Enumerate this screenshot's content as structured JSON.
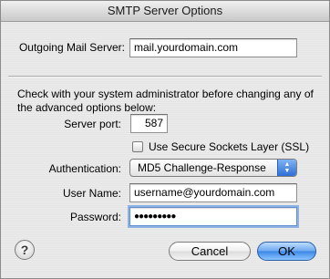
{
  "window": {
    "title": "SMTP Server Options"
  },
  "outgoing": {
    "label": "Outgoing Mail Server:",
    "value": "mail.yourdomain.com"
  },
  "note": "Check with your system administrator before changing any of the advanced options below:",
  "port": {
    "label": "Server port:",
    "value": "587"
  },
  "ssl": {
    "label": "Use Secure Sockets Layer (SSL)",
    "checked": false
  },
  "authentication": {
    "label": "Authentication:",
    "selected": "MD5 Challenge-Response"
  },
  "username": {
    "label": "User Name:",
    "value": "username@yourdomain.com"
  },
  "password": {
    "label": "Password:",
    "masked": "●●●●●●●●●"
  },
  "buttons": {
    "help": "?",
    "cancel": "Cancel",
    "ok": "OK"
  },
  "colors": {
    "accent": "#3a86e6",
    "focus_ring": "#8db2e3"
  }
}
